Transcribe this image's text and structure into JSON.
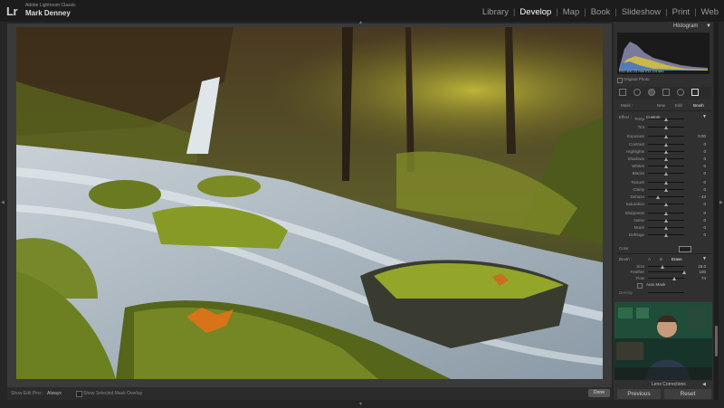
{
  "app": {
    "logo": "Lr",
    "product": "Adobe Lightroom Classic",
    "user": "Mark Denney"
  },
  "modules": [
    {
      "label": "Library",
      "active": false
    },
    {
      "label": "Develop",
      "active": true
    },
    {
      "label": "Map",
      "active": false
    },
    {
      "label": "Book",
      "active": false
    },
    {
      "label": "Slideshow",
      "active": false
    },
    {
      "label": "Print",
      "active": false
    },
    {
      "label": "Web",
      "active": false
    }
  ],
  "panel": {
    "histogram": {
      "title": "Histogram",
      "info": "ISO 400     23 mm     f/11     1/4 sec",
      "original_photo": "Original Photo"
    },
    "mask": {
      "label": "Mask :",
      "new": "New",
      "edit": "Edit",
      "brush": "Brush"
    },
    "effect": {
      "label": "Effect :",
      "value": "Custom"
    },
    "sliders": [
      {
        "label": "Temp",
        "value": "",
        "pos": 0.5
      },
      {
        "label": "Tint",
        "value": "",
        "pos": 0.5
      },
      {
        "label": "Exposure",
        "value": "0.00",
        "pos": 0.5
      },
      {
        "label": "Contrast",
        "value": "0",
        "pos": 0.5
      },
      {
        "label": "Highlights",
        "value": "0",
        "pos": 0.5
      },
      {
        "label": "Shadows",
        "value": "0",
        "pos": 0.5
      },
      {
        "label": "Whites",
        "value": "0",
        "pos": 0.5
      },
      {
        "label": "Blacks",
        "value": "0",
        "pos": 0.5
      },
      {
        "label": "Texture",
        "value": "0",
        "pos": 0.5
      },
      {
        "label": "Clarity",
        "value": "0",
        "pos": 0.5
      },
      {
        "label": "Dehaze",
        "value": "- 43",
        "pos": 0.285
      },
      {
        "label": "Saturation",
        "value": "0",
        "pos": 0.5
      },
      {
        "label": "Sharpness",
        "value": "0",
        "pos": 0.5
      },
      {
        "label": "Noise",
        "value": "0",
        "pos": 0.5
      },
      {
        "label": "Moiré",
        "value": "0",
        "pos": 0.5
      },
      {
        "label": "Defringe",
        "value": "0",
        "pos": 0.5
      }
    ],
    "color_label": "Color",
    "brush": {
      "label": "Brush :",
      "a": "A",
      "b": "B",
      "erase": "Erase",
      "settings": [
        {
          "label": "Size",
          "value": "15.0",
          "pos": 0.4
        },
        {
          "label": "Feather",
          "value": "100",
          "pos": 1.0
        },
        {
          "label": "Flow",
          "value": "74",
          "pos": 0.74
        }
      ],
      "auto_mask": "Auto Mask",
      "density": "Density"
    },
    "lens_corrections": "Lens Corrections",
    "previous": "Previous",
    "reset": "Reset"
  },
  "toolbar": {
    "edit_pins_label": "Show Edit Pins :",
    "edit_pins_value": "Always",
    "mask_overlay": "Show Selected Mask Overlay",
    "done": "Done"
  },
  "colors": {
    "background": "#262626",
    "panel": "#303030",
    "active_module": "#ffffff",
    "inactive_module": "#9a9a9a"
  }
}
